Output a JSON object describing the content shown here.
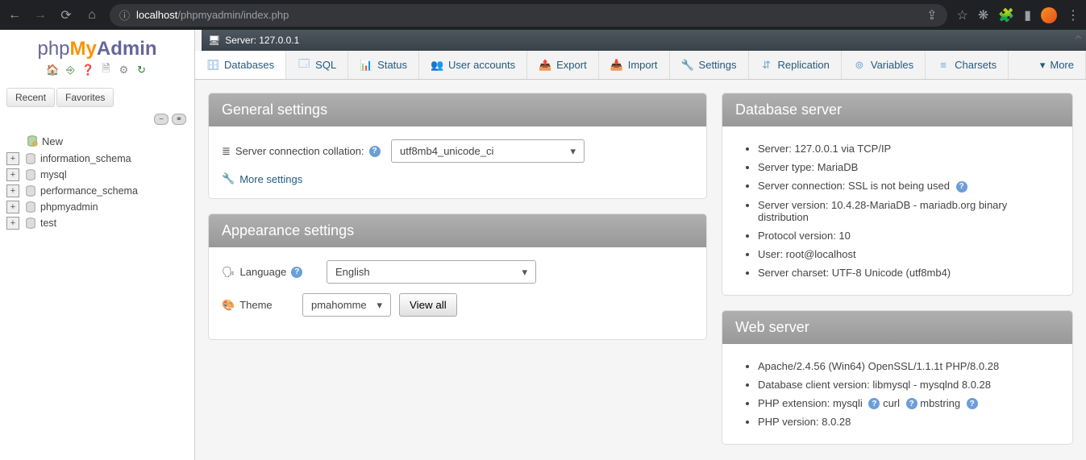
{
  "browser": {
    "url_host": "localhost",
    "url_path": "/phpmyadmin/index.php"
  },
  "logo": {
    "php": "php",
    "my": "My",
    "admin": "Admin"
  },
  "sidebar": {
    "tabs": {
      "recent": "Recent",
      "favorites": "Favorites"
    },
    "new_label": "New",
    "databases": [
      {
        "name": "information_schema"
      },
      {
        "name": "mysql"
      },
      {
        "name": "performance_schema"
      },
      {
        "name": "phpmyadmin"
      },
      {
        "name": "test"
      }
    ]
  },
  "server_bar": {
    "label": "Server: 127.0.0.1"
  },
  "topnav": {
    "items": [
      {
        "label": "Databases",
        "icon": "db",
        "color": "#6ea6d8"
      },
      {
        "label": "SQL",
        "icon": "sql",
        "color": "#6ea6d8"
      },
      {
        "label": "Status",
        "icon": "status",
        "color": "#e07676"
      },
      {
        "label": "User accounts",
        "icon": "users",
        "color": "#6ea6d8"
      },
      {
        "label": "Export",
        "icon": "export",
        "color": "#5ba05b"
      },
      {
        "label": "Import",
        "icon": "import",
        "color": "#d86a6a"
      },
      {
        "label": "Settings",
        "icon": "wrench",
        "color": "#a8a060"
      },
      {
        "label": "Replication",
        "icon": "replication",
        "color": "#6ea6d8"
      },
      {
        "label": "Variables",
        "icon": "variables",
        "color": "#6ea6d8"
      },
      {
        "label": "Charsets",
        "icon": "charsets",
        "color": "#6ea6d8"
      }
    ],
    "more": "More"
  },
  "general": {
    "title": "General settings",
    "collation_label": "Server connection collation:",
    "collation_value": "utf8mb4_unicode_ci",
    "more_settings": "More settings"
  },
  "appearance": {
    "title": "Appearance settings",
    "language_label": "Language",
    "language_value": "English",
    "theme_label": "Theme",
    "theme_value": "pmahomme",
    "view_all": "View all"
  },
  "db_server": {
    "title": "Database server",
    "items": [
      "Server: 127.0.0.1 via TCP/IP",
      "Server type: MariaDB",
      "Server connection: SSL is not being used",
      "Server version: 10.4.28-MariaDB - mariadb.org binary distribution",
      "Protocol version: 10",
      "User: root@localhost",
      "Server charset: UTF-8 Unicode (utf8mb4)"
    ],
    "help_after_index": 2
  },
  "web_server": {
    "title": "Web server",
    "items": [
      "Apache/2.4.56 (Win64) OpenSSL/1.1.1t PHP/8.0.28",
      "Database client version: libmysql - mysqlnd 8.0.28",
      "PHP extension: mysqli",
      "PHP version: 8.0.28"
    ],
    "ext_extras": [
      "curl",
      "mbstring"
    ]
  }
}
